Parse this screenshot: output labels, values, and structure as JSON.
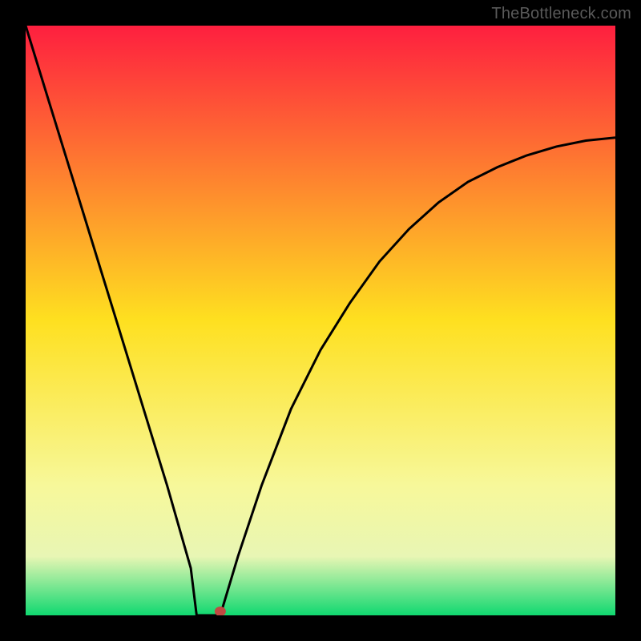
{
  "watermark": "TheBottleneck.com",
  "colors": {
    "frame": "#000000",
    "top": "#fe2040",
    "mid": "#fee020",
    "bottom_green": "#0fd870",
    "line": "#000000",
    "marker": "#c04a42"
  },
  "chart_data": {
    "type": "line",
    "title": "",
    "xlabel": "",
    "ylabel": "",
    "xlim": [
      0,
      100
    ],
    "ylim": [
      0,
      100
    ],
    "marker": {
      "x": 33,
      "y": 0
    },
    "notch": {
      "x_start": 29,
      "x_end": 33,
      "y": 0
    },
    "series": [
      {
        "name": "curve",
        "x": [
          0,
          4,
          8,
          12,
          16,
          20,
          24,
          28,
          29,
          33,
          36,
          40,
          45,
          50,
          55,
          60,
          65,
          70,
          75,
          80,
          85,
          90,
          95,
          100
        ],
        "y": [
          100,
          87,
          74,
          61,
          48,
          35,
          22,
          8,
          0,
          0,
          10,
          22,
          35,
          45,
          53,
          60,
          65.5,
          70,
          73.5,
          76,
          78,
          79.5,
          80.5,
          81
        ]
      }
    ],
    "background": {
      "type": "vertical-gradient",
      "stops": [
        {
          "pos": 0.0,
          "color": "#fe1f3f"
        },
        {
          "pos": 0.5,
          "color": "#fee020"
        },
        {
          "pos": 0.78,
          "color": "#f7f89a"
        },
        {
          "pos": 0.9,
          "color": "#e8f6b4"
        },
        {
          "pos": 1.0,
          "color": "#10d870"
        }
      ]
    }
  }
}
